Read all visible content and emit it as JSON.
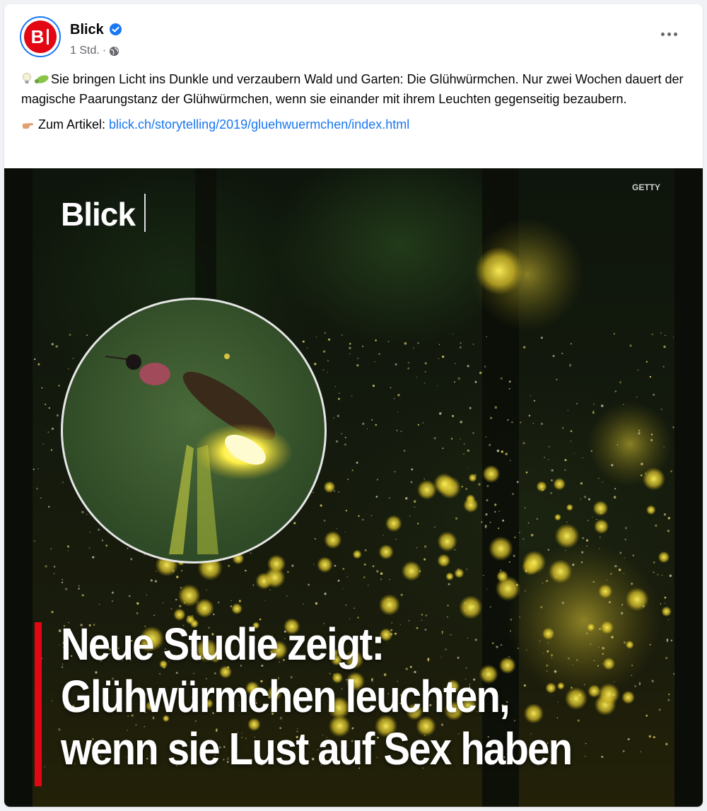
{
  "post": {
    "page_name": "Blick",
    "timestamp": "1 Std.",
    "separator": "·",
    "avatar_letter": "B",
    "text_line1": "Sie bringen Licht ins Dunkle und verzaubern Wald und Garten: Die Glühwürmchen. Nur zwei Wochen dauert der magische Paarungstanz der Glühwürmchen, wenn sie einander mit ihrem Leuchten gegenseitig bezaubern.",
    "link_prefix": "Zum Artikel: ",
    "link_text": "blick.ch/storytelling/2019/gluehwuermchen/index.html"
  },
  "image": {
    "brand": "Blick",
    "credit": "GETTY",
    "headline": [
      "Neue Studie zeigt:",
      "Glühwürmchen leuchten,",
      "wenn sie Lust auf Sex haben"
    ]
  },
  "icons": {
    "verified": "verified-badge-icon",
    "privacy": "globe-icon",
    "more": "more-options-icon",
    "emoji1": "lightbulb-emoji-icon",
    "emoji2": "bug-emoji-icon",
    "emoji3": "pointing-hand-emoji-icon"
  },
  "colors": {
    "link": "#1877f2",
    "brand_red": "#e30613",
    "verified_blue": "#1877f2",
    "meta_gray": "#65676b"
  }
}
